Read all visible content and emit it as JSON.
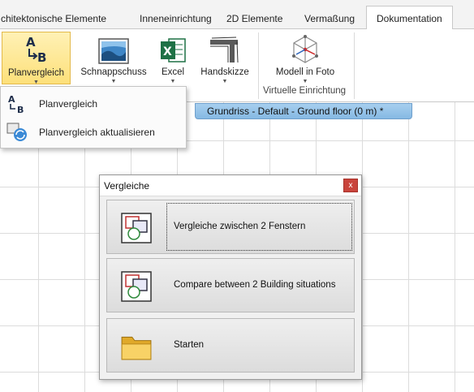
{
  "tabs": [
    {
      "label": "chitektonische Elemente"
    },
    {
      "label": "Inneneinrichtung"
    },
    {
      "label": "2D Elemente"
    },
    {
      "label": "Vermaßung"
    },
    {
      "label": "Dokumentation"
    }
  ],
  "ribbon": {
    "planvergleich_label": "Planvergleich",
    "schnappschuss_label": "Schnappschuss",
    "excel_label": "Excel",
    "handskizze_label": "Handskizze",
    "modell_in_foto_label": "Modell in Foto",
    "group_virtuelle_einrichtung": "Virtuelle Einrichtung",
    "excel_icon_letter": "X"
  },
  "dropdown": {
    "items": [
      {
        "label": "Planvergleich"
      },
      {
        "label": "Planvergleich aktualisieren"
      }
    ]
  },
  "document_tab": {
    "title": "Grundriss - Default - Ground floor (0 m) *"
  },
  "dialog": {
    "title": "Vergleiche",
    "close_glyph": "x",
    "buttons": [
      {
        "label": "Vergleiche zwischen 2 Fenstern"
      },
      {
        "label": "Compare between 2 Building situations"
      },
      {
        "label": "Starten"
      }
    ]
  },
  "colors": {
    "selected_button": "#fde07a",
    "document_tab": "#86b9e3",
    "close_button": "#c9443c",
    "excel_green": "#1e7145",
    "folder_yellow": "#f3c448"
  }
}
